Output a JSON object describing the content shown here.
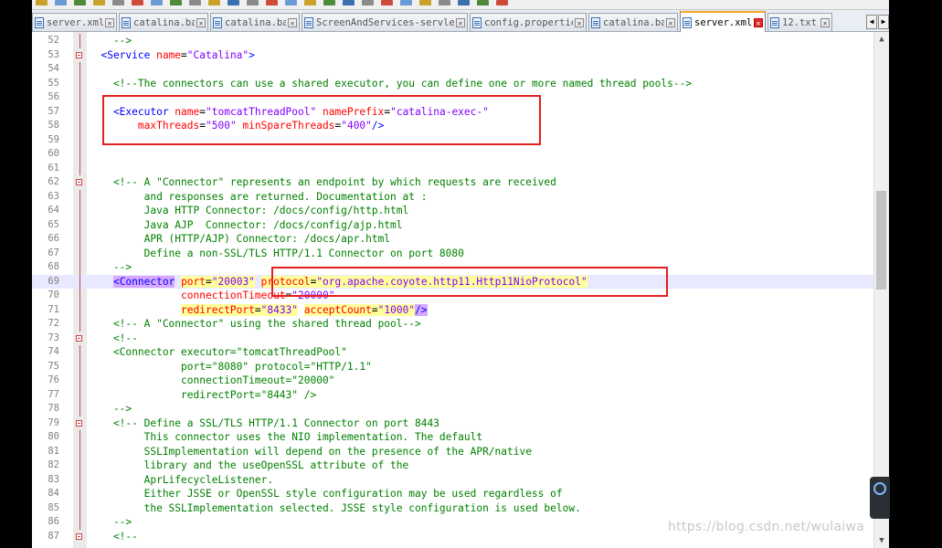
{
  "tabs": [
    {
      "label": "server.xml",
      "active": false
    },
    {
      "label": "catalina.bat",
      "active": false
    },
    {
      "label": "catalina.bat",
      "active": false
    },
    {
      "label": "ScreenAndServices-servlet.xml",
      "active": false
    },
    {
      "label": "config.properties",
      "active": false
    },
    {
      "label": "catalina.bat",
      "active": false
    },
    {
      "label": "server.xml",
      "active": true
    },
    {
      "label": "12.txt",
      "active": false
    }
  ],
  "tab_close_glyph": "✕",
  "scroll_glyphs": {
    "left": "◀",
    "right": "▶",
    "up": "▲",
    "down": "▼"
  },
  "lines": [
    {
      "n": "52",
      "tokens": [
        [
          "c",
          "    -->"
        ]
      ]
    },
    {
      "n": "53",
      "fold": true,
      "tokens": [
        [
          "t",
          "  <Service "
        ],
        [
          "a",
          "name"
        ],
        [
          "p",
          "="
        ],
        [
          "v",
          "\"Catalina\""
        ],
        [
          "t",
          ">"
        ]
      ]
    },
    {
      "n": "54",
      "tokens": []
    },
    {
      "n": "55",
      "tokens": [
        [
          "c",
          "    <!--The connectors can use a shared executor, you can define one or more named thread pools-->"
        ]
      ]
    },
    {
      "n": "56",
      "tokens": []
    },
    {
      "n": "57",
      "tokens": [
        [
          "t",
          "    <Executor "
        ],
        [
          "a",
          "name"
        ],
        [
          "p",
          "="
        ],
        [
          "v",
          "\"tomcatThreadPool\""
        ],
        [
          "a",
          " namePrefix"
        ],
        [
          "p",
          "="
        ],
        [
          "v",
          "\"catalina-exec-\""
        ]
      ]
    },
    {
      "n": "58",
      "tokens": [
        [
          "a",
          "        maxThreads"
        ],
        [
          "p",
          "="
        ],
        [
          "v",
          "\"500\""
        ],
        [
          "a",
          " minSpareThreads"
        ],
        [
          "p",
          "="
        ],
        [
          "v",
          "\"400\""
        ],
        [
          "t",
          "/>"
        ]
      ]
    },
    {
      "n": "59",
      "tokens": []
    },
    {
      "n": "60",
      "tokens": []
    },
    {
      "n": "61",
      "tokens": []
    },
    {
      "n": "62",
      "fold": true,
      "tokens": [
        [
          "c",
          "    <!-- A \"Connector\" represents an endpoint by which requests are received"
        ]
      ]
    },
    {
      "n": "63",
      "tokens": [
        [
          "c",
          "         and responses are returned. Documentation at :"
        ]
      ]
    },
    {
      "n": "64",
      "tokens": [
        [
          "c",
          "         Java HTTP Connector: /docs/config/http.html"
        ]
      ]
    },
    {
      "n": "65",
      "tokens": [
        [
          "c",
          "         Java AJP  Connector: /docs/config/ajp.html"
        ]
      ]
    },
    {
      "n": "66",
      "tokens": [
        [
          "c",
          "         APR (HTTP/AJP) Connector: /docs/apr.html"
        ]
      ]
    },
    {
      "n": "67",
      "tokens": [
        [
          "c",
          "         Define a non-SSL/TLS HTTP/1.1 Connector on port 8080"
        ]
      ]
    },
    {
      "n": "68",
      "tokens": [
        [
          "c",
          "    -->"
        ]
      ]
    },
    {
      "n": "69",
      "current": true,
      "tokens": [
        [
          "p",
          "    "
        ],
        [
          "t bm",
          "<Connector"
        ],
        [
          "p",
          " "
        ],
        [
          "a hl",
          "port"
        ],
        [
          "p hl",
          "="
        ],
        [
          "v hl",
          "\"20003\""
        ],
        [
          "p",
          " "
        ],
        [
          "a hl",
          "protocol"
        ],
        [
          "p hl",
          "="
        ],
        [
          "v hl",
          "\"org.apache.coyote.http11.Http11NioProtocol\""
        ]
      ]
    },
    {
      "n": "70",
      "tokens": [
        [
          "a",
          "               connectionTimeout"
        ],
        [
          "p",
          "="
        ],
        [
          "v",
          "\"20000\""
        ]
      ]
    },
    {
      "n": "71",
      "tokens": [
        [
          "p",
          "               "
        ],
        [
          "a hl",
          "redirectPort"
        ],
        [
          "p hl",
          "="
        ],
        [
          "v hl",
          "\"8433\""
        ],
        [
          "p",
          " "
        ],
        [
          "a hl",
          "acceptCount"
        ],
        [
          "p hl",
          "="
        ],
        [
          "v hl",
          "\"1000\""
        ],
        [
          "t bm",
          "/>"
        ]
      ]
    },
    {
      "n": "72",
      "tokens": [
        [
          "c",
          "    <!-- A \"Connector\" using the shared thread pool-->"
        ]
      ]
    },
    {
      "n": "73",
      "fold": true,
      "tokens": [
        [
          "c",
          "    <!--"
        ]
      ]
    },
    {
      "n": "74",
      "tokens": [
        [
          "c",
          "    <Connector executor=\"tomcatThreadPool\""
        ]
      ]
    },
    {
      "n": "75",
      "tokens": [
        [
          "c",
          "               port=\"8080\" protocol=\"HTTP/1.1\""
        ]
      ]
    },
    {
      "n": "76",
      "tokens": [
        [
          "c",
          "               connectionTimeout=\"20000\""
        ]
      ]
    },
    {
      "n": "77",
      "tokens": [
        [
          "c",
          "               redirectPort=\"8443\" />"
        ]
      ]
    },
    {
      "n": "78",
      "tokens": [
        [
          "c",
          "    -->"
        ]
      ]
    },
    {
      "n": "79",
      "fold": true,
      "tokens": [
        [
          "c",
          "    <!-- Define a SSL/TLS HTTP/1.1 Connector on port 8443"
        ]
      ]
    },
    {
      "n": "80",
      "tokens": [
        [
          "c",
          "         This connector uses the NIO implementation. The default"
        ]
      ]
    },
    {
      "n": "81",
      "tokens": [
        [
          "c",
          "         SSLImplementation will depend on the presence of the APR/native"
        ]
      ]
    },
    {
      "n": "82",
      "tokens": [
        [
          "c",
          "         library and the useOpenSSL attribute of the"
        ]
      ]
    },
    {
      "n": "83",
      "tokens": [
        [
          "c",
          "         AprLifecycleListener."
        ]
      ]
    },
    {
      "n": "84",
      "tokens": [
        [
          "c",
          "         Either JSSE or OpenSSL style configuration may be used regardless of"
        ]
      ]
    },
    {
      "n": "85",
      "tokens": [
        [
          "c",
          "         the SSLImplementation selected. JSSE style configuration is used below."
        ]
      ]
    },
    {
      "n": "86",
      "tokens": [
        [
          "c",
          "    -->"
        ]
      ]
    },
    {
      "n": "87",
      "fold": true,
      "tokens": [
        [
          "c",
          "    <!--"
        ]
      ]
    }
  ],
  "watermark": "https://blog.csdn.net/wulaiwa",
  "colors": {
    "tag": "#0000ff",
    "attribute": "#ff0000",
    "value": "#8000ff",
    "comment": "#008000",
    "annotation_box": "#e61e1e",
    "active_tab_accent": "#f5a623"
  }
}
